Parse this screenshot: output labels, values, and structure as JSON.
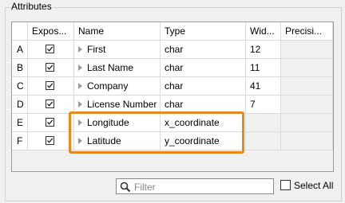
{
  "group_title": "Attributes",
  "columns": [
    "",
    "Expos...",
    "Name",
    "Type",
    "Wid...",
    "Precisi..."
  ],
  "rows": [
    {
      "id": "A",
      "exposed": true,
      "name": "First",
      "type": "char",
      "width": "12",
      "precision": ""
    },
    {
      "id": "B",
      "exposed": true,
      "name": "Last Name",
      "type": "char",
      "width": "11",
      "precision": ""
    },
    {
      "id": "C",
      "exposed": true,
      "name": "Company",
      "type": "char",
      "width": "41",
      "precision": ""
    },
    {
      "id": "D",
      "exposed": true,
      "name": "License Number",
      "type": "char",
      "width": "7",
      "precision": ""
    },
    {
      "id": "E",
      "exposed": true,
      "name": "Longitude",
      "type": "x_coordinate",
      "width": "",
      "precision": ""
    },
    {
      "id": "F",
      "exposed": true,
      "name": "Latitude",
      "type": "y_coordinate",
      "width": "",
      "precision": ""
    }
  ],
  "filter": {
    "placeholder": "Filter",
    "icon": "search-icon"
  },
  "select_all": {
    "label": "Select All",
    "checked": false
  },
  "highlight_color": "#e8891e"
}
